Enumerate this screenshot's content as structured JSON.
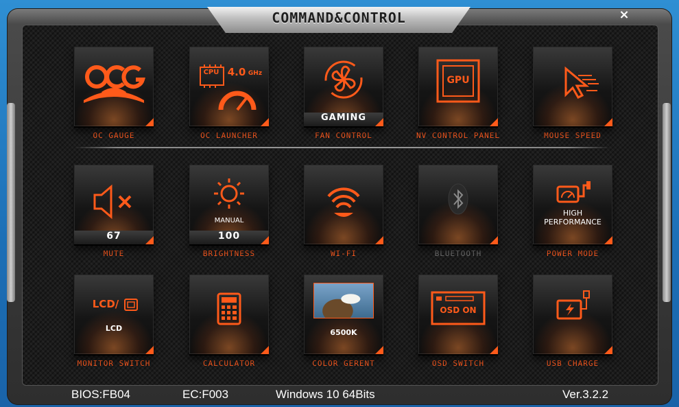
{
  "window": {
    "title": "COMMAND&CONTROL",
    "close_label": "×"
  },
  "colors": {
    "accent": "#ff5a1a",
    "background": "#1b1b1b",
    "text": "#ffffff"
  },
  "tiles": [
    {
      "caption": "OC GAUGE",
      "icon": "ocg-logo-icon"
    },
    {
      "caption": "OC LAUNCHER",
      "icon": "cpu-speed-icon",
      "cpu_text": "CPU",
      "freq_text": "4.0",
      "unit_text": "GHz"
    },
    {
      "caption": "FAN CONTROL",
      "icon": "fan-icon",
      "mode": "GAMING"
    },
    {
      "caption": "NV CONTROL PANEL",
      "icon": "gpu-icon",
      "gpu_text": "GPU"
    },
    {
      "caption": "MOUSE SPEED",
      "icon": "mouse-cursor-icon"
    },
    {
      "caption": "MUTE",
      "icon": "speaker-muted-icon",
      "value": "67"
    },
    {
      "caption": "BRIGHTNESS",
      "icon": "sun-icon",
      "mode": "MANUAL",
      "value": "100"
    },
    {
      "caption": "WI-FI",
      "icon": "wifi-icon"
    },
    {
      "caption": "BLUETOOTH",
      "icon": "bluetooth-icon"
    },
    {
      "caption": "POWER MODE",
      "icon": "power-gauge-icon",
      "mode_line1": "HIGH",
      "mode_line2": "PERFORMANCE"
    },
    {
      "caption": "MONITOR SWITCH",
      "icon": "monitor-switch-icon",
      "lcd_text": "LCD/",
      "mode": "LCD"
    },
    {
      "caption": "CALCULATOR",
      "icon": "calculator-icon"
    },
    {
      "caption": "COLOR GERENT",
      "icon": "eagle-photo-icon",
      "mode": "6500K"
    },
    {
      "caption": "OSD SWITCH",
      "icon": "osd-icon",
      "osd_text": "OSD ON"
    },
    {
      "caption": "USB CHARGE",
      "icon": "usb-charge-icon"
    }
  ],
  "status": {
    "bios": "BIOS:FB04",
    "ec": "EC:F003",
    "os": "Windows 10 64Bits",
    "version": "Ver.3.2.2"
  }
}
